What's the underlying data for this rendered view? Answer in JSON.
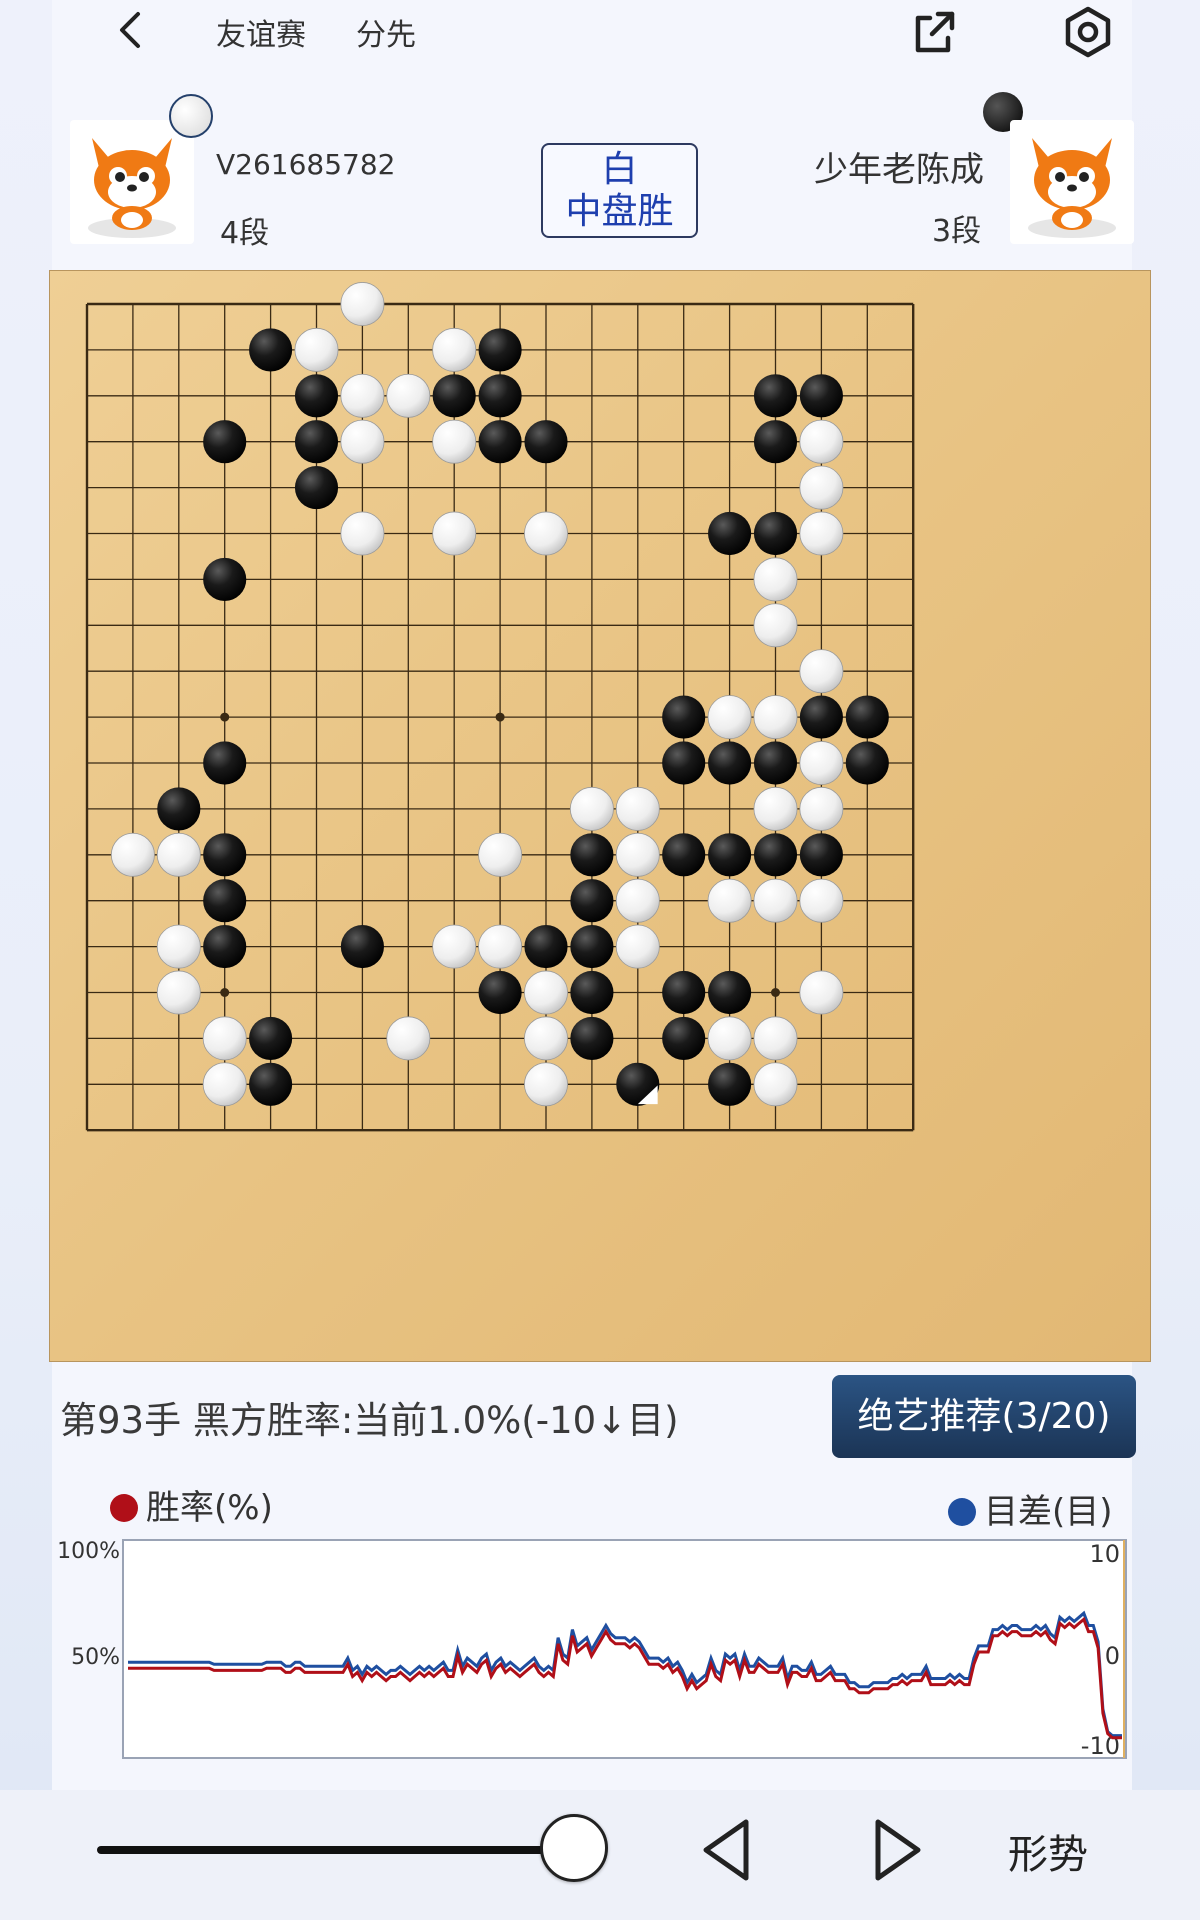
{
  "header": {
    "game_type": "友谊赛",
    "rule": "分先"
  },
  "players": {
    "white": {
      "name": "V261685782",
      "rank": "4段"
    },
    "black": {
      "name": "少年老陈成",
      "rank": "3段"
    }
  },
  "result": {
    "line1": "白",
    "line2": "中盘胜"
  },
  "board": {
    "size": 19,
    "last_move": [
      12,
      17
    ],
    "black": [
      [
        4,
        1
      ],
      [
        9,
        1
      ],
      [
        5,
        2
      ],
      [
        8,
        2
      ],
      [
        9,
        2
      ],
      [
        15,
        2
      ],
      [
        16,
        2
      ],
      [
        3,
        3
      ],
      [
        5,
        3
      ],
      [
        9,
        3
      ],
      [
        10,
        3
      ],
      [
        15,
        3
      ],
      [
        5,
        4
      ],
      [
        14,
        5
      ],
      [
        15,
        5
      ],
      [
        3,
        6
      ],
      [
        13,
        9
      ],
      [
        16,
        9
      ],
      [
        17,
        9
      ],
      [
        3,
        10
      ],
      [
        13,
        10
      ],
      [
        14,
        10
      ],
      [
        15,
        10
      ],
      [
        17,
        10
      ],
      [
        2,
        11
      ],
      [
        3,
        12
      ],
      [
        11,
        12
      ],
      [
        13,
        12
      ],
      [
        14,
        12
      ],
      [
        15,
        12
      ],
      [
        16,
        12
      ],
      [
        3,
        13
      ],
      [
        11,
        13
      ],
      [
        3,
        14
      ],
      [
        6,
        14
      ],
      [
        10,
        14
      ],
      [
        11,
        14
      ],
      [
        9,
        15
      ],
      [
        11,
        15
      ],
      [
        13,
        15
      ],
      [
        14,
        15
      ],
      [
        4,
        16
      ],
      [
        11,
        16
      ],
      [
        13,
        16
      ],
      [
        4,
        17
      ],
      [
        12,
        17
      ],
      [
        14,
        17
      ]
    ],
    "white": [
      [
        6,
        0
      ],
      [
        5,
        1
      ],
      [
        8,
        1
      ],
      [
        6,
        2
      ],
      [
        7,
        2
      ],
      [
        16,
        3
      ],
      [
        6,
        3
      ],
      [
        8,
        3
      ],
      [
        16,
        4
      ],
      [
        6,
        5
      ],
      [
        8,
        5
      ],
      [
        10,
        5
      ],
      [
        16,
        5
      ],
      [
        15,
        6
      ],
      [
        15,
        7
      ],
      [
        16,
        8
      ],
      [
        14,
        9
      ],
      [
        15,
        9
      ],
      [
        16,
        10
      ],
      [
        11,
        11
      ],
      [
        12,
        11
      ],
      [
        15,
        11
      ],
      [
        16,
        11
      ],
      [
        1,
        12
      ],
      [
        2,
        12
      ],
      [
        9,
        12
      ],
      [
        12,
        12
      ],
      [
        12,
        13
      ],
      [
        14,
        13
      ],
      [
        15,
        13
      ],
      [
        16,
        13
      ],
      [
        2,
        14
      ],
      [
        8,
        14
      ],
      [
        9,
        14
      ],
      [
        12,
        14
      ],
      [
        2,
        15
      ],
      [
        10,
        15
      ],
      [
        16,
        15
      ],
      [
        3,
        16
      ],
      [
        7,
        16
      ],
      [
        10,
        16
      ],
      [
        14,
        16
      ],
      [
        15,
        16
      ],
      [
        3,
        17
      ],
      [
        10,
        17
      ],
      [
        15,
        17
      ]
    ]
  },
  "move_info": "第93手  黑方胜率:当前1.0%(-10↓目)",
  "recommend_button": "绝艺推荐(3/20)",
  "chart_data": {
    "type": "line",
    "legend_left": "胜率(%)",
    "legend_right": "目差(目)",
    "y_left_ticks": [
      "100%",
      "50%"
    ],
    "y_right_ticks": [
      "10",
      "0",
      "-10"
    ],
    "colors": {
      "winrate": "#b00f18",
      "score": "#1f4fa0"
    },
    "series": [
      {
        "name": "胜率(%)",
        "values": [
          42,
          42,
          42,
          42,
          42,
          42,
          42,
          42,
          42,
          42,
          42,
          42,
          42,
          42,
          42,
          42,
          42,
          42,
          41,
          41,
          41,
          41,
          41,
          41,
          41,
          41,
          41,
          41,
          41,
          42,
          42,
          42,
          42,
          40,
          40,
          42,
          42,
          40,
          40,
          40,
          40,
          40,
          40,
          40,
          40,
          40,
          44,
          38,
          40,
          36,
          40,
          38,
          40,
          38,
          36,
          38,
          38,
          40,
          38,
          36,
          38,
          40,
          38,
          40,
          38,
          40,
          42,
          38,
          38,
          48,
          40,
          44,
          42,
          40,
          44,
          46,
          38,
          42,
          44,
          40,
          42,
          40,
          38,
          40,
          42,
          44,
          40,
          38,
          40,
          38,
          54,
          46,
          44,
          58,
          50,
          52,
          54,
          48,
          52,
          56,
          60,
          56,
          54,
          54,
          54,
          52,
          54,
          52,
          48,
          44,
          44,
          44,
          42,
          44,
          40,
          42,
          38,
          32,
          36,
          32,
          34,
          36,
          44,
          38,
          36,
          46,
          44,
          46,
          38,
          46,
          40,
          40,
          44,
          42,
          40,
          40,
          40,
          44,
          34,
          40,
          40,
          38,
          38,
          42,
          36,
          36,
          38,
          40,
          36,
          36,
          36,
          32,
          32,
          30,
          30,
          30,
          32,
          32,
          32,
          32,
          34,
          34,
          36,
          34,
          36,
          36,
          36,
          40,
          34,
          34,
          34,
          34,
          36,
          34,
          36,
          34,
          34,
          44,
          50,
          50,
          50,
          58,
          58,
          60,
          58,
          60,
          60,
          58,
          58,
          58,
          60,
          58,
          60,
          56,
          54,
          64,
          62,
          64,
          62,
          64,
          66,
          60,
          60,
          52,
          20,
          10,
          8,
          8,
          8
        ]
      },
      {
        "name": "目差(目)",
        "values": [
          45,
          45,
          45,
          45,
          45,
          45,
          45,
          45,
          45,
          45,
          45,
          45,
          45,
          45,
          45,
          45,
          45,
          45,
          44,
          44,
          44,
          44,
          44,
          44,
          44,
          44,
          44,
          44,
          44,
          45,
          45,
          45,
          45,
          43,
          43,
          45,
          45,
          43,
          43,
          43,
          43,
          43,
          43,
          43,
          43,
          43,
          47,
          41,
          43,
          39,
          43,
          41,
          43,
          41,
          39,
          41,
          41,
          43,
          41,
          39,
          41,
          43,
          41,
          43,
          41,
          43,
          45,
          41,
          41,
          51,
          43,
          47,
          45,
          43,
          47,
          49,
          41,
          45,
          47,
          43,
          45,
          43,
          41,
          43,
          45,
          47,
          43,
          41,
          43,
          41,
          57,
          49,
          47,
          61,
          53,
          55,
          57,
          51,
          55,
          59,
          63,
          59,
          57,
          57,
          57,
          55,
          57,
          55,
          51,
          47,
          47,
          47,
          45,
          47,
          43,
          45,
          41,
          35,
          39,
          35,
          37,
          39,
          47,
          41,
          39,
          49,
          47,
          49,
          41,
          49,
          43,
          43,
          47,
          45,
          43,
          43,
          43,
          47,
          37,
          43,
          43,
          41,
          41,
          45,
          39,
          39,
          41,
          43,
          39,
          39,
          39,
          35,
          35,
          33,
          33,
          33,
          35,
          35,
          35,
          35,
          37,
          37,
          39,
          37,
          39,
          39,
          39,
          43,
          37,
          37,
          37,
          37,
          39,
          37,
          39,
          37,
          37,
          47,
          53,
          53,
          53,
          61,
          61,
          63,
          61,
          63,
          63,
          61,
          61,
          61,
          63,
          61,
          63,
          59,
          57,
          67,
          65,
          67,
          65,
          67,
          69,
          63,
          63,
          55,
          22,
          11,
          9,
          9,
          9
        ]
      }
    ],
    "ylim": [
      0,
      100
    ]
  },
  "bottom": {
    "slider_fraction": 1.0,
    "form_button": "形势"
  }
}
